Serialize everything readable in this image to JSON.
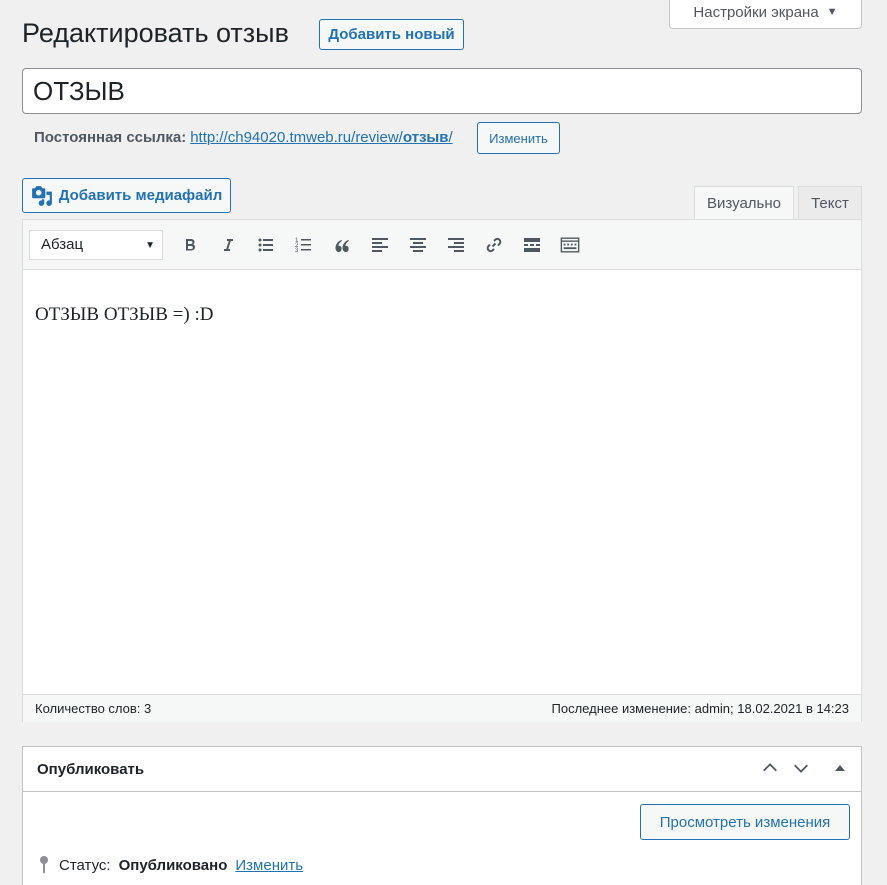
{
  "screen_options": {
    "label": "Настройки экрана",
    "caret": "▼"
  },
  "header": {
    "title": "Редактировать отзыв",
    "add_new": "Добавить новый"
  },
  "post": {
    "title": "ОТЗЫВ"
  },
  "permalink": {
    "label": "Постоянная ссылка:",
    "url_prefix": "http://ch94020.tmweb.ru/review/",
    "slug": "отзыв",
    "url_suffix": "/",
    "edit_label": "Изменить"
  },
  "media": {
    "add_label": "Добавить медиафайл"
  },
  "editor": {
    "tabs": {
      "visual": "Визуально",
      "text": "Текст"
    },
    "format_select": "Абзац",
    "content": "ОТЗЫВ ОТЗЫВ =) :D",
    "word_count_label": "Количество слов: 3",
    "last_edited": "Последнее изменение: admin; 18.02.2021 в 14:23"
  },
  "publish": {
    "heading": "Опубликовать",
    "preview_label": "Просмотреть изменения",
    "status_label": "Статус:",
    "status_value": "Опубликовано",
    "status_edit": "Изменить"
  },
  "colors": {
    "accent": "#2271b1",
    "background": "#f0f0f1"
  }
}
